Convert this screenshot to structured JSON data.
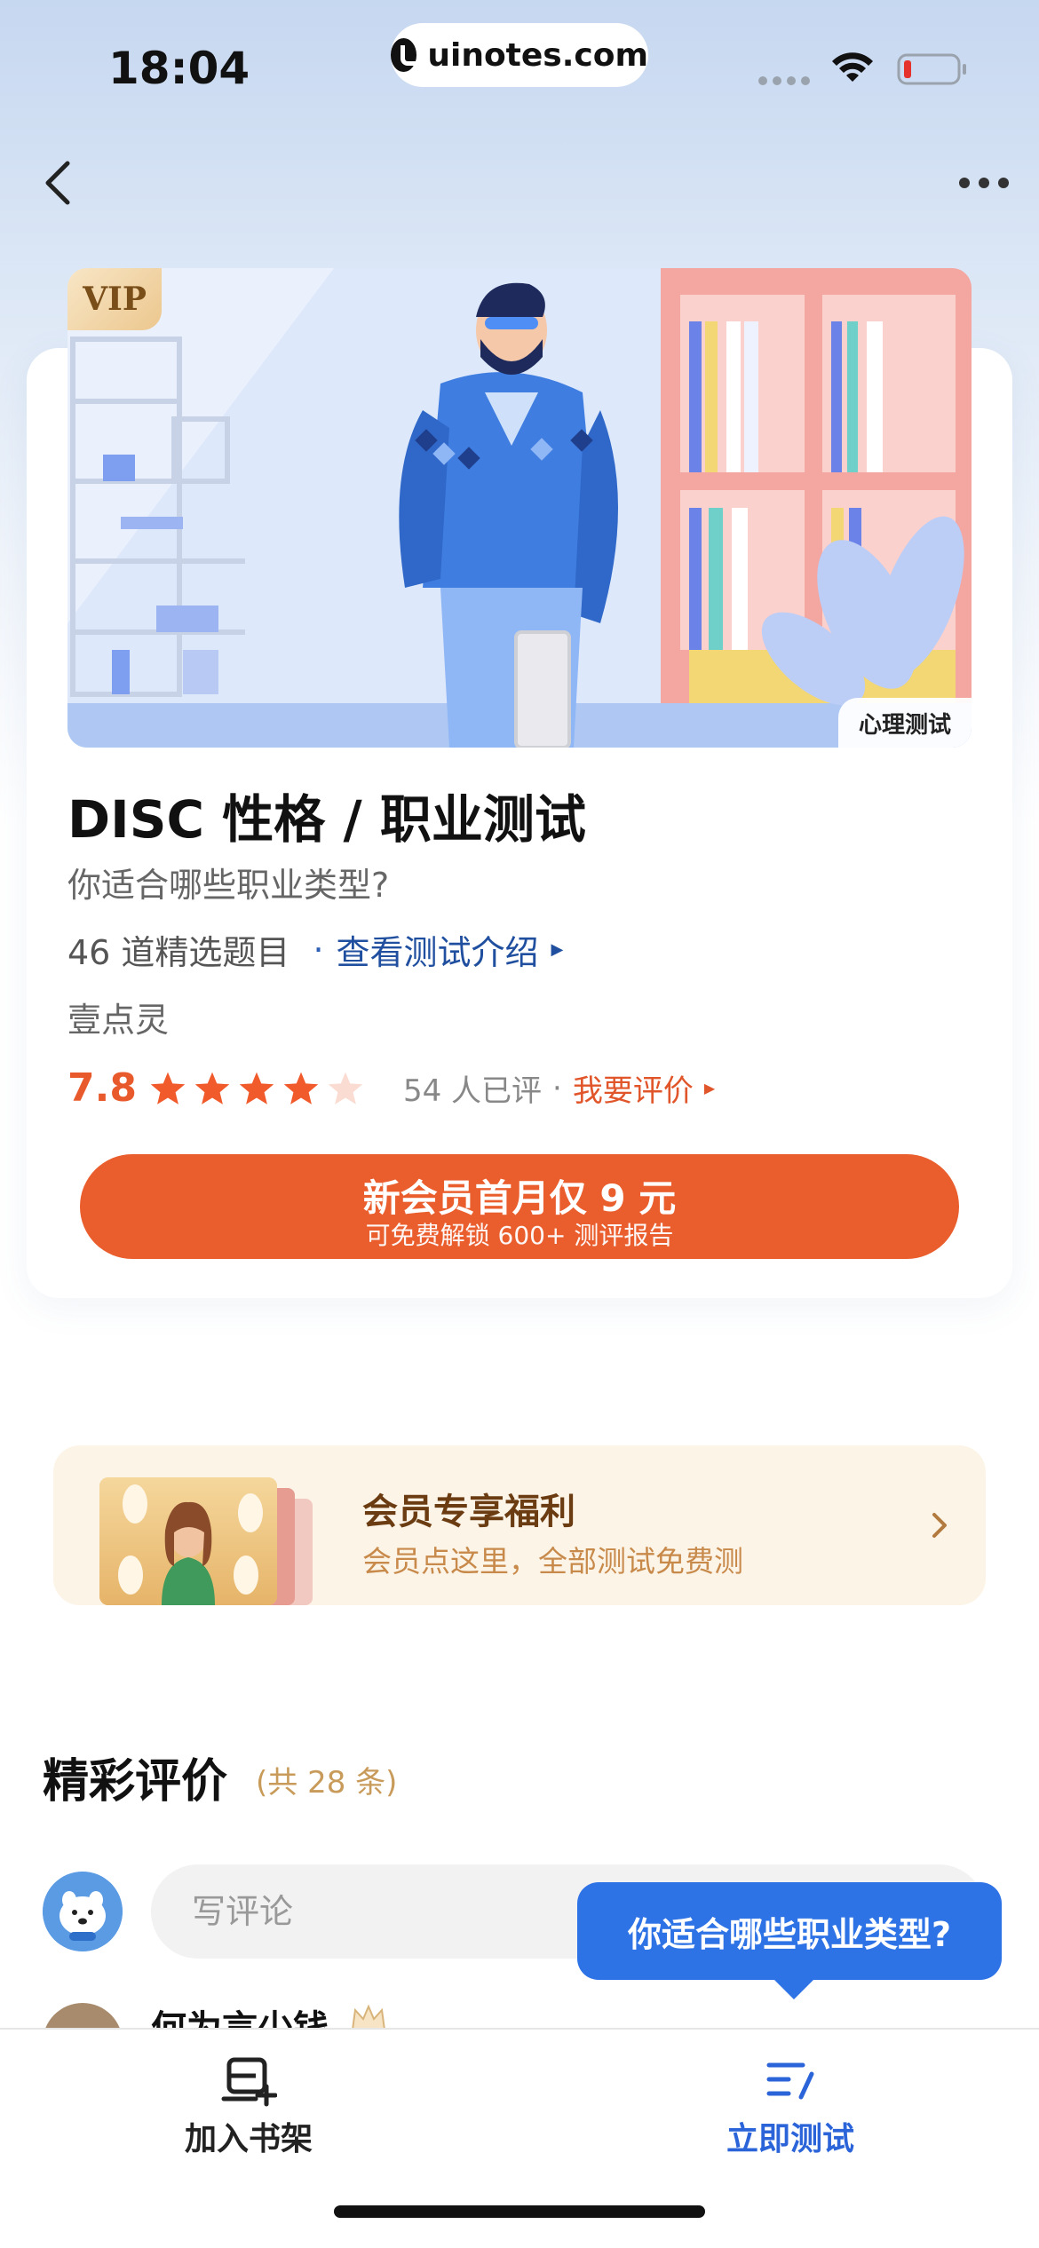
{
  "status_bar": {
    "time": "18:04",
    "url": "uinotes.com"
  },
  "nav": {
    "back_icon": "chevron-left-icon",
    "more_icon": "more-horizontal-icon"
  },
  "card": {
    "vip_badge": "VIP",
    "category_tag": "心理测试",
    "title": "DISC 性格 / 职业测试",
    "subtitle": "你适合哪些职业类型?",
    "question_count": "46 道精选题目",
    "intro_separator": "·",
    "intro_link": "查看测试介绍",
    "author": "壹点灵",
    "rating": {
      "score": "7.8",
      "stars": 4.5,
      "max_stars": 5,
      "count_text": "54 人已评",
      "separator": "·",
      "rate_link": "我要评价"
    },
    "cta": {
      "main": "新会员首月仅 9 元",
      "sub": "可免费解锁 600+ 测评报告"
    }
  },
  "benefit": {
    "title": "会员专享福利",
    "subtitle": "会员点这里，全部测试免费测"
  },
  "reviews": {
    "title": "精彩评价",
    "count": "(共 28 条)",
    "comment_placeholder": "写评论",
    "first_reviewer": "何为言少钱"
  },
  "tooltip": {
    "text": "你适合哪些职业类型?"
  },
  "bottom_bar": {
    "left_label": "加入书架",
    "right_label": "立即测试"
  },
  "colors": {
    "accent": "#ea5e2e",
    "link_blue": "#1f4f9e",
    "primary_blue": "#2a64d8",
    "star_fill": "#f15a2b"
  }
}
